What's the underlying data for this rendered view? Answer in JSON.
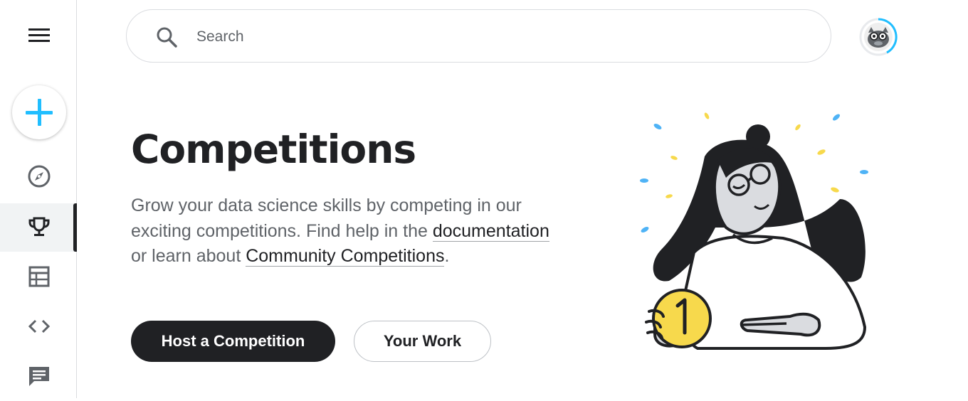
{
  "sidebar": {
    "menu_icon": "menu-icon",
    "create_icon": "plus-icon",
    "accent_color": "#20BEFF",
    "items": [
      {
        "name": "explore",
        "icon": "compass-icon",
        "active": false
      },
      {
        "name": "competitions",
        "icon": "trophy-icon",
        "active": true
      },
      {
        "name": "datasets",
        "icon": "table-icon",
        "active": false
      },
      {
        "name": "code",
        "icon": "code-icon",
        "active": false
      },
      {
        "name": "discussions",
        "icon": "comment-icon",
        "active": false
      }
    ]
  },
  "header": {
    "search": {
      "placeholder": "Search",
      "value": ""
    },
    "avatar_icon": "user-avatar"
  },
  "main": {
    "title": "Competitions",
    "description": {
      "part1": "Grow your data science skills by competing in our exciting competitions. Find help in the ",
      "link1": "documentation",
      "part2": " or learn about ",
      "link2": "Community Competitions",
      "part3": "."
    },
    "buttons": {
      "host": "Host a Competition",
      "your_work": "Your Work"
    },
    "illustration": "person-holding-gold-coin-illustration"
  }
}
